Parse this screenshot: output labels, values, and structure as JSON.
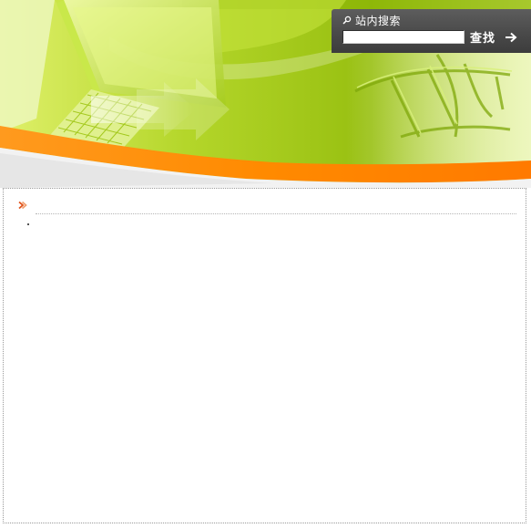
{
  "search": {
    "title": "站内搜索",
    "input_value": "",
    "placeholder": "",
    "button_label": "查找"
  },
  "content": {
    "section_title": ""
  },
  "colors": {
    "banner_green": "#9cc313",
    "banner_orange": "#ff8a00",
    "search_panel": "#4f4f4f",
    "bullet": "#e0531b"
  },
  "icons": {
    "search": "magnifier-icon",
    "go": "arrow-right-icon",
    "bullet": "double-chevron-icon"
  }
}
